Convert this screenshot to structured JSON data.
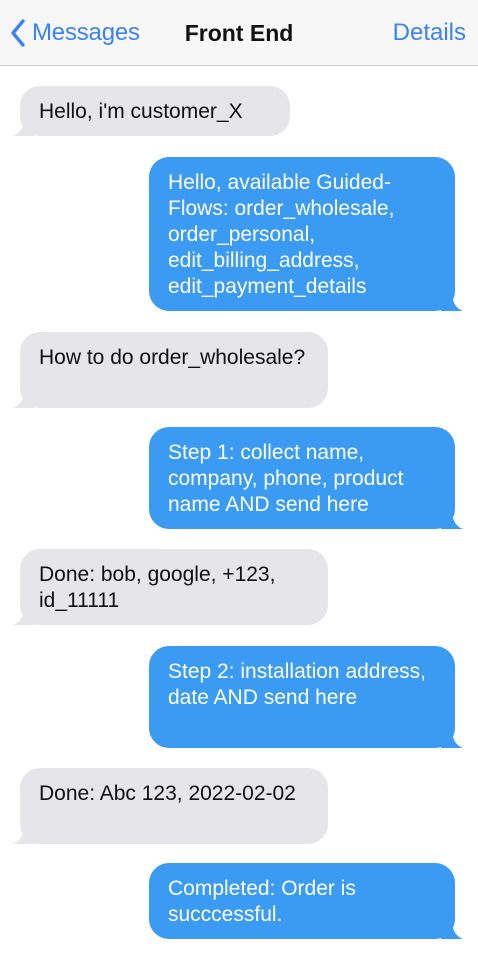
{
  "nav": {
    "back_label": "Messages",
    "title": "Front End",
    "details_label": "Details"
  },
  "colors": {
    "accent": "#3b82f6",
    "sent_bubble": "#3b9bf2",
    "received_bubble": "#e5e5ea"
  },
  "messages": [
    {
      "direction": "received",
      "text": "Hello, i'm customer_X"
    },
    {
      "direction": "sent",
      "text": "Hello, available Guided-Flows: order_wholesale, order_personal, edit_billing_address, edit_payment_details"
    },
    {
      "direction": "received",
      "text": "How to do order_wholesale?"
    },
    {
      "direction": "sent",
      "text": "Step 1: collect name, company, phone, product name AND send here"
    },
    {
      "direction": "received",
      "text": "Done: bob, google, +123, id_11111"
    },
    {
      "direction": "sent",
      "text": "Step 2: installation address, date AND send here"
    },
    {
      "direction": "received",
      "text": "Done: Abc 123, 2022-02-02"
    },
    {
      "direction": "sent",
      "text": "Completed: Order is succcessful."
    }
  ]
}
